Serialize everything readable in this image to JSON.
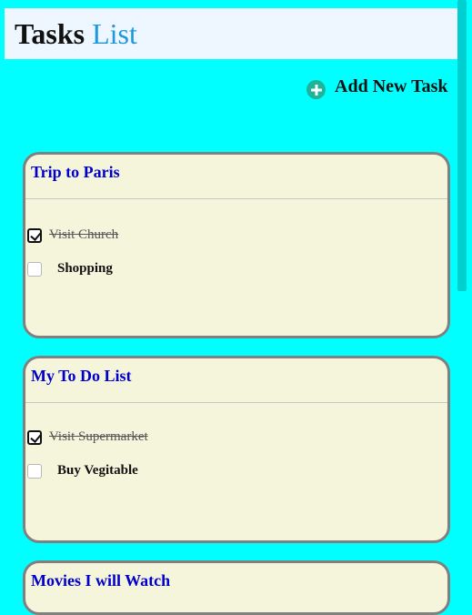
{
  "header": {
    "title_part1": "Tasks",
    "title_part2": "List"
  },
  "toolbar": {
    "add_task_label": "Add New Task",
    "add_icon": "plus-circle-icon"
  },
  "colors": {
    "page_background": "#00ffff",
    "header_background": "#eef6ff",
    "card_background": "#f5f5dc",
    "card_title": "#0000cc",
    "title_accent": "#1b98e0",
    "add_icon": "#1fb39a"
  },
  "lists": [
    {
      "title": "Trip to Paris",
      "tasks": [
        {
          "label": "Visit Church",
          "done": true
        },
        {
          "label": "Shopping",
          "done": false
        }
      ]
    },
    {
      "title": "My To Do List",
      "tasks": [
        {
          "label": "Visit Supermarket",
          "done": true
        },
        {
          "label": "Buy Vegitable",
          "done": false
        }
      ]
    },
    {
      "title": "Movies I will Watch",
      "tasks": []
    }
  ]
}
